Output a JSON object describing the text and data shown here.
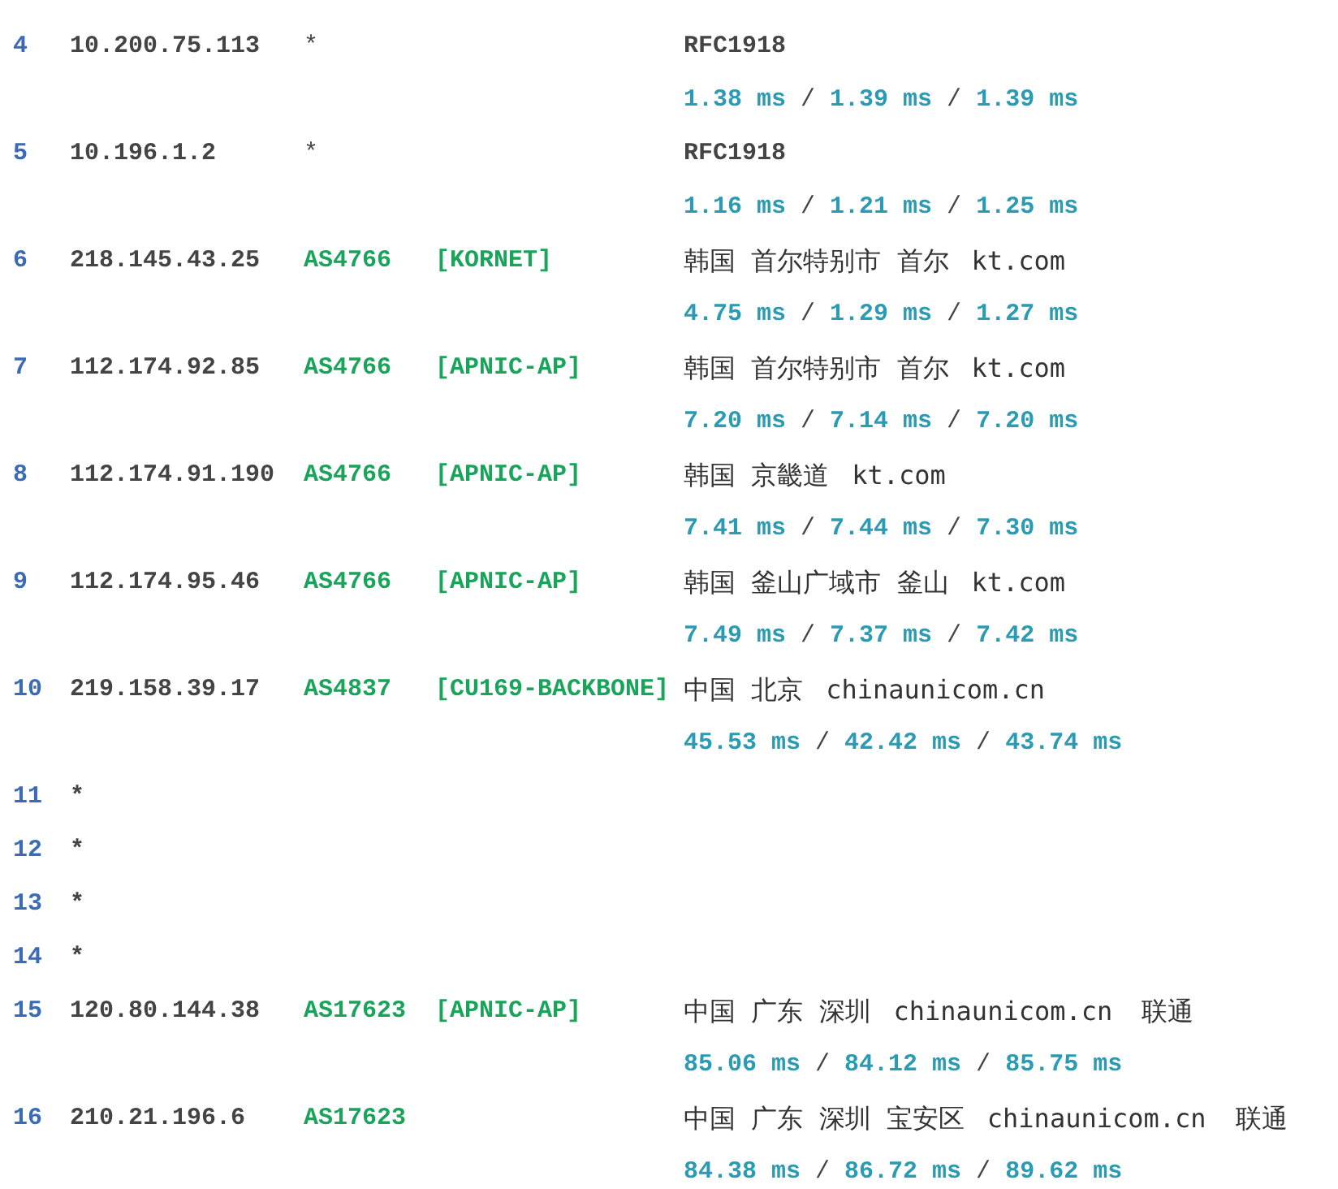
{
  "hops": [
    {
      "hop": "4",
      "kind": "private",
      "ip": "10.200.75.113",
      "asn": "*",
      "location": "RFC1918",
      "timings": "**1.38 ms** / **1.39 ms** / **1.39 ms**"
    },
    {
      "hop": "5",
      "kind": "private",
      "ip": "10.196.1.2",
      "asn": "*",
      "location": "RFC1918",
      "timings": "**1.16 ms** / **1.21 ms** / **1.25 ms**"
    },
    {
      "hop": "6",
      "kind": "public",
      "ip": "218.145.43.25",
      "asn": "AS4766",
      "org": "[KORNET]",
      "location": "韩国 首尔特别市 首尔",
      "domain": "kt.com",
      "timings": "**4.75 ms** / **1.29 ms** / **1.27 ms**"
    },
    {
      "hop": "7",
      "kind": "public",
      "ip": "112.174.92.85",
      "asn": "AS4766",
      "org": "[APNIC-AP]",
      "location": "韩国 首尔特别市 首尔",
      "domain": "kt.com",
      "timings": "**7.20 ms** / **7.14 ms** / **7.20 ms**"
    },
    {
      "hop": "8",
      "kind": "public",
      "ip": "112.174.91.190",
      "asn": "AS4766",
      "org": "[APNIC-AP]",
      "location": "韩国 京畿道",
      "domain": "kt.com",
      "timings": "**7.41 ms** / **7.44 ms** / **7.30 ms**"
    },
    {
      "hop": "9",
      "kind": "public",
      "ip": "112.174.95.46",
      "asn": "AS4766",
      "org": "[APNIC-AP]",
      "location": "韩国 釜山广域市 釜山",
      "domain": "kt.com",
      "timings": "**7.49 ms** / **7.37 ms** / **7.42 ms**"
    },
    {
      "hop": "10",
      "kind": "public",
      "ip": "219.158.39.17",
      "asn": "AS4837",
      "org": "[CU169-BACKBONE]",
      "location": "中国 北京",
      "domain": "chinaunicom.cn",
      "timings": "**45.53 ms** / **42.42 ms** / **43.74 ms**"
    },
    {
      "hop": "11",
      "kind": "timeout",
      "ip": "*"
    },
    {
      "hop": "12",
      "kind": "timeout",
      "ip": "*"
    },
    {
      "hop": "13",
      "kind": "timeout",
      "ip": "*"
    },
    {
      "hop": "14",
      "kind": "timeout",
      "ip": "*"
    },
    {
      "hop": "15",
      "kind": "public",
      "ip": "120.80.144.38",
      "asn": "AS17623",
      "org": "[APNIC-AP]",
      "location": "中国 广东 深圳",
      "domain": "chinaunicom.cn",
      "isp": "联通",
      "timings": "**85.06 ms** / **84.12 ms** / **85.75 ms**"
    },
    {
      "hop": "16",
      "kind": "public",
      "ip": "210.21.196.6",
      "asn": "AS17623",
      "location": "中国 广东 深圳 宝安区",
      "domain": "chinaunicom.cn",
      "isp": "联通",
      "timings": "**84.38 ms** / **86.72 ms** / **89.62 ms**"
    }
  ]
}
